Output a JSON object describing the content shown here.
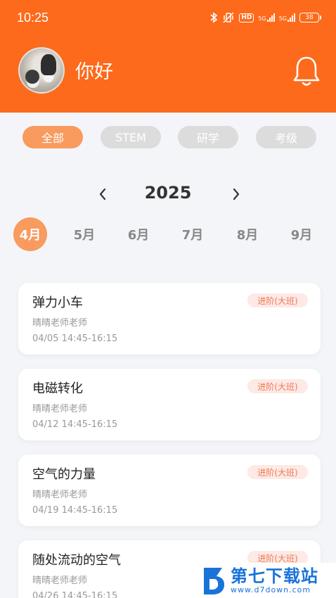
{
  "status_bar": {
    "time": "10:25",
    "hd": "HD",
    "net1": "5G",
    "net2": "5G",
    "battery": "38"
  },
  "header": {
    "greeting": "你好"
  },
  "filters": [
    {
      "label": "全部",
      "active": true
    },
    {
      "label": "STEM",
      "active": false
    },
    {
      "label": "研学",
      "active": false
    },
    {
      "label": "考级",
      "active": false
    }
  ],
  "calendar": {
    "year": "2025",
    "months": [
      {
        "label": "4月",
        "active": true
      },
      {
        "label": "5月",
        "active": false
      },
      {
        "label": "6月",
        "active": false
      },
      {
        "label": "7月",
        "active": false
      },
      {
        "label": "8月",
        "active": false
      },
      {
        "label": "9月",
        "active": false
      }
    ]
  },
  "courses": [
    {
      "title": "弹力小车",
      "badge": "进阶(大班)",
      "teacher": "晴晴老师老师",
      "time": "04/05 14:45-16:15"
    },
    {
      "title": "电磁转化",
      "badge": "进阶(大班)",
      "teacher": "晴晴老师老师",
      "time": "04/12 14:45-16:15"
    },
    {
      "title": "空气的力量",
      "badge": "进阶(大班)",
      "teacher": "晴晴老师老师",
      "time": "04/19 14:45-16:15"
    },
    {
      "title": "随处流动的空气",
      "badge": "进阶(大班)",
      "teacher": "晴晴老师老师",
      "time": "04/26 14:45-16:15"
    }
  ],
  "watermark": {
    "title": "第七下载站",
    "url": "www.d7down.com"
  },
  "colors": {
    "brand": "#fd6a1b",
    "accent": "#f99a5e",
    "chip_inactive": "#dcdcdc",
    "badge_bg": "#fde9e5",
    "badge_text": "#f07a55"
  }
}
